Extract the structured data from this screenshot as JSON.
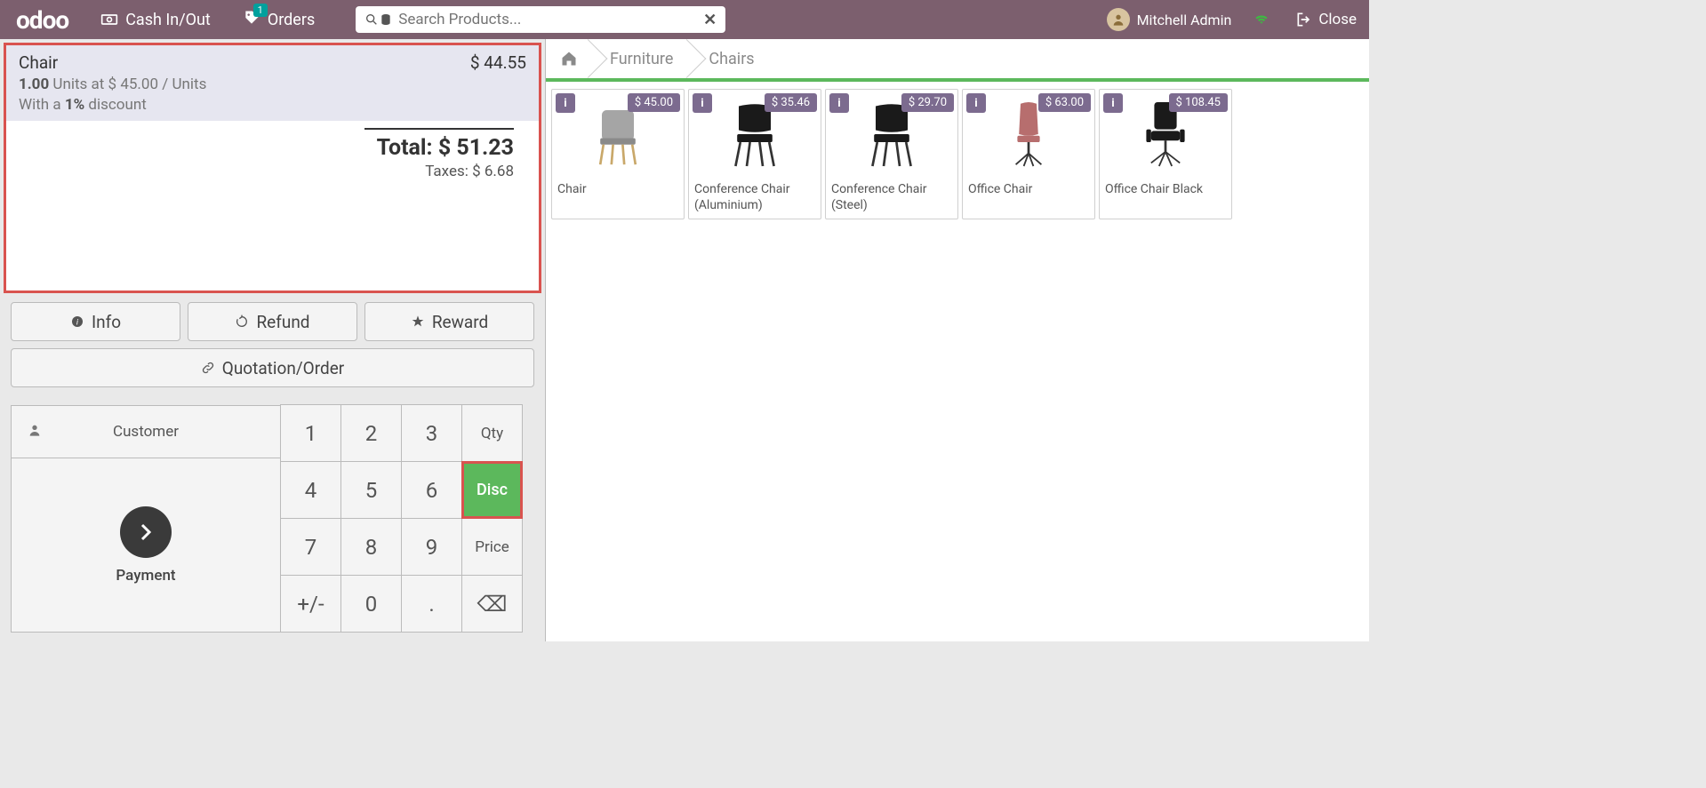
{
  "header": {
    "logo": "odoo",
    "cash_label": "Cash In/Out",
    "orders_label": "Orders",
    "orders_count": "1",
    "search_placeholder": "Search Products...",
    "username": "Mitchell Admin",
    "close_label": "Close"
  },
  "order": {
    "line": {
      "name": "Chair",
      "price": "$ 44.55",
      "qty": "1.00",
      "units_label": "Units at",
      "unit_price": "$ 45.00",
      "per_label": "/ Units",
      "with_label": "With a",
      "discount_pct": "1%",
      "discount_label": "discount"
    },
    "total_label": "Total:",
    "total_value": "$ 51.23",
    "taxes_label": "Taxes:",
    "taxes_value": "$ 6.68"
  },
  "controls": {
    "info": "Info",
    "refund": "Refund",
    "reward": "Reward",
    "quotation": "Quotation/Order"
  },
  "keypad": {
    "customer": "Customer",
    "payment": "Payment",
    "keys": [
      "1",
      "2",
      "3",
      "4",
      "5",
      "6",
      "7",
      "8",
      "9",
      "+/-",
      "0",
      "."
    ],
    "qty": "Qty",
    "disc": "Disc",
    "price": "Price",
    "backspace": "⌫"
  },
  "breadcrumb": {
    "home": "home",
    "items": [
      "Furniture",
      "Chairs"
    ]
  },
  "products": [
    {
      "name": "Chair",
      "price": "$ 45.00"
    },
    {
      "name": "Conference Chair (Aluminium)",
      "price": "$ 35.46"
    },
    {
      "name": "Conference Chair (Steel)",
      "price": "$ 29.70"
    },
    {
      "name": "Office Chair",
      "price": "$ 63.00"
    },
    {
      "name": "Office Chair Black",
      "price": "$ 108.45"
    }
  ]
}
